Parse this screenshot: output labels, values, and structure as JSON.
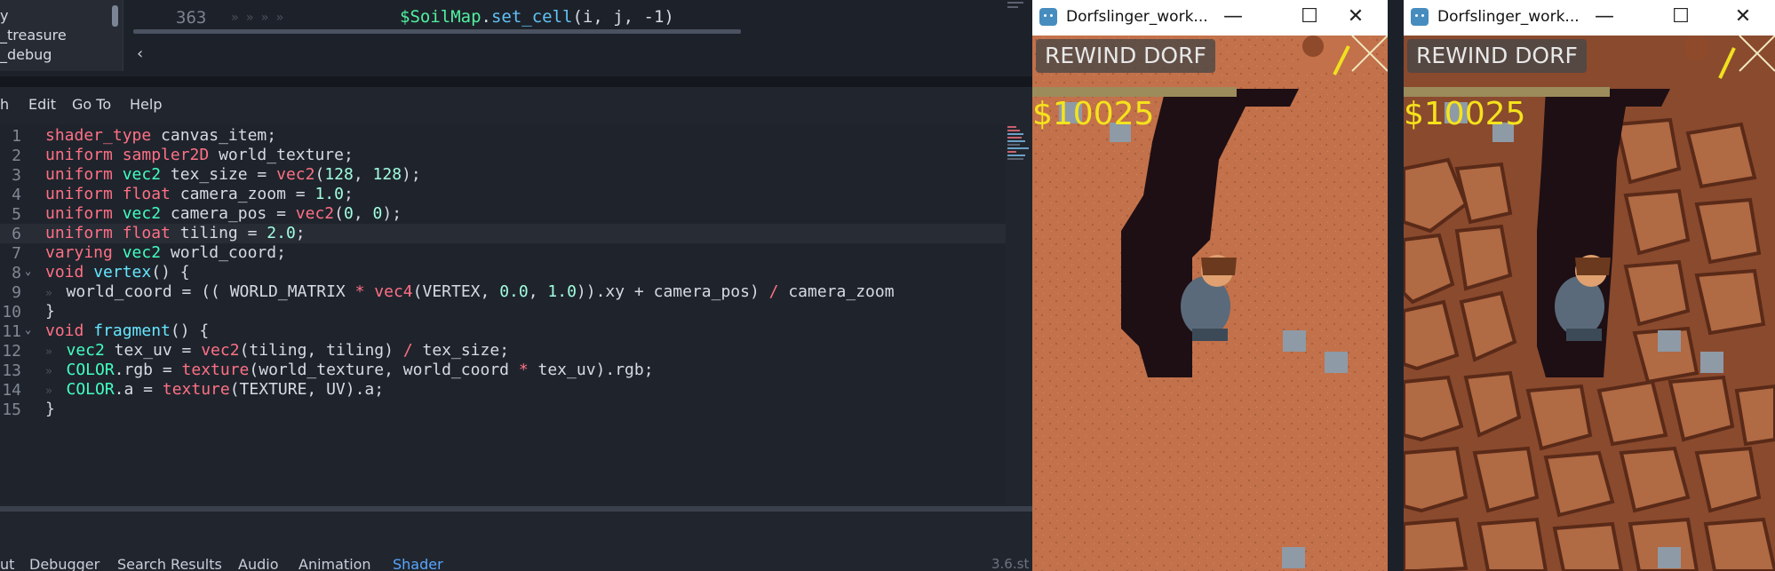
{
  "file_tree": {
    "items": [
      "y",
      "_treasure",
      "_debug"
    ]
  },
  "mini_code": {
    "line_number": "363",
    "segments": [
      {
        "text": "$SoilMap",
        "cls": "tok-var"
      },
      {
        "text": ".",
        "cls": "tok-def"
      },
      {
        "text": "set_cell",
        "cls": "tok-fn"
      },
      {
        "text": "(i, j, -1)",
        "cls": "tok-def"
      }
    ]
  },
  "menu": {
    "items": [
      "h",
      "Edit",
      "Go To",
      "Help"
    ]
  },
  "code": {
    "current_line": 6,
    "lines": [
      {
        "n": "1",
        "fold": "",
        "tokens": [
          [
            "kw",
            "shader_type"
          ],
          [
            "pl",
            " canvas_item;"
          ]
        ]
      },
      {
        "n": "2",
        "fold": "",
        "tokens": [
          [
            "kw",
            "uniform"
          ],
          [
            "pl",
            " "
          ],
          [
            "kw",
            "sampler2D"
          ],
          [
            "pl",
            " world_texture;"
          ]
        ]
      },
      {
        "n": "3",
        "fold": "",
        "tokens": [
          [
            "kw",
            "uniform"
          ],
          [
            "pl",
            " "
          ],
          [
            "ty",
            "vec2"
          ],
          [
            "pl",
            " tex_size = "
          ],
          [
            "kw",
            "vec2"
          ],
          [
            "pl",
            "("
          ],
          [
            "num",
            "128"
          ],
          [
            "pl",
            ", "
          ],
          [
            "num",
            "128"
          ],
          [
            "pl",
            ");"
          ]
        ]
      },
      {
        "n": "4",
        "fold": "",
        "tokens": [
          [
            "kw",
            "uniform"
          ],
          [
            "pl",
            " "
          ],
          [
            "kw",
            "float"
          ],
          [
            "pl",
            " camera_zoom = "
          ],
          [
            "num",
            "1.0"
          ],
          [
            "pl",
            ";"
          ]
        ]
      },
      {
        "n": "5",
        "fold": "",
        "tokens": [
          [
            "kw",
            "uniform"
          ],
          [
            "pl",
            " "
          ],
          [
            "ty",
            "vec2"
          ],
          [
            "pl",
            " camera_pos = "
          ],
          [
            "kw",
            "vec2"
          ],
          [
            "pl",
            "("
          ],
          [
            "num",
            "0"
          ],
          [
            "pl",
            ", "
          ],
          [
            "num",
            "0"
          ],
          [
            "pl",
            ");"
          ]
        ]
      },
      {
        "n": "6",
        "fold": "",
        "tokens": [
          [
            "kw",
            "uniform"
          ],
          [
            "pl",
            " "
          ],
          [
            "kw",
            "float"
          ],
          [
            "pl",
            " tiling = "
          ],
          [
            "num",
            "2.0"
          ],
          [
            "pl",
            ";"
          ]
        ]
      },
      {
        "n": "7",
        "fold": "",
        "tokens": [
          [
            "kw",
            "varying"
          ],
          [
            "pl",
            " "
          ],
          [
            "ty",
            "vec2"
          ],
          [
            "pl",
            " world_coord;"
          ]
        ]
      },
      {
        "n": "8",
        "fold": "⌄",
        "tokens": [
          [
            "kw",
            "void"
          ],
          [
            "pl",
            " "
          ],
          [
            "fnc",
            "vertex"
          ],
          [
            "pl",
            "() {"
          ]
        ]
      },
      {
        "n": "9",
        "fold": "",
        "tokens": [
          [
            "ind",
            "»  "
          ],
          [
            "pl",
            "world_coord = (( WORLD_MATRIX "
          ],
          [
            "kw",
            "*"
          ],
          [
            "pl",
            " "
          ],
          [
            "kw",
            "vec4"
          ],
          [
            "pl",
            "(VERTEX, "
          ],
          [
            "num",
            "0.0"
          ],
          [
            "pl",
            ", "
          ],
          [
            "num",
            "1.0"
          ],
          [
            "pl",
            ")).xy + camera_pos) "
          ],
          [
            "kw",
            "/"
          ],
          [
            "pl",
            " camera_zoom"
          ]
        ]
      },
      {
        "n": "10",
        "fold": "",
        "tokens": [
          [
            "pl",
            "}"
          ]
        ]
      },
      {
        "n": "11",
        "fold": "⌄",
        "tokens": [
          [
            "kw",
            "void"
          ],
          [
            "pl",
            " "
          ],
          [
            "fnc",
            "fragment"
          ],
          [
            "pl",
            "() {"
          ]
        ]
      },
      {
        "n": "12",
        "fold": "",
        "tokens": [
          [
            "ind",
            "»  "
          ],
          [
            "ty",
            "vec2"
          ],
          [
            "pl",
            " tex_uv = "
          ],
          [
            "kw",
            "vec2"
          ],
          [
            "pl",
            "(tiling, tiling) "
          ],
          [
            "kw",
            "/"
          ],
          [
            "pl",
            " tex_size;"
          ]
        ]
      },
      {
        "n": "13",
        "fold": "",
        "tokens": [
          [
            "ind",
            "»  "
          ],
          [
            "ty",
            "COLOR"
          ],
          [
            "pl",
            ".rgb = "
          ],
          [
            "kw",
            "texture"
          ],
          [
            "pl",
            "(world_texture, world_coord "
          ],
          [
            "kw",
            "*"
          ],
          [
            "pl",
            " tex_uv).rgb;"
          ]
        ]
      },
      {
        "n": "14",
        "fold": "",
        "tokens": [
          [
            "ind",
            "»  "
          ],
          [
            "ty",
            "COLOR"
          ],
          [
            "pl",
            ".a = "
          ],
          [
            "kw",
            "texture"
          ],
          [
            "pl",
            "(TEXTURE, UV).a;"
          ]
        ]
      },
      {
        "n": "15",
        "fold": "",
        "tokens": [
          [
            "pl",
            "}"
          ]
        ]
      }
    ]
  },
  "bottom_tabs": {
    "items": [
      {
        "label": "ut",
        "active": false
      },
      {
        "label": "Debugger",
        "active": false
      },
      {
        "label": "Search Results",
        "active": false
      },
      {
        "label": "Audio",
        "active": false
      },
      {
        "label": "Animation",
        "active": false
      },
      {
        "label": "Shader",
        "active": true
      }
    ]
  },
  "status": {
    "version": "3.6.st"
  },
  "windows": [
    {
      "title": "Dorfslinger_work...",
      "button": "REWIND DORF",
      "money": "$10025",
      "ground": "soil",
      "minimize": "—",
      "maximize": "☐",
      "close": "✕"
    },
    {
      "title": "Dorfslinger_work...",
      "button": "REWIND DORF",
      "money": "$10025",
      "ground": "rock",
      "minimize": "—",
      "maximize": "☐",
      "close": "✕"
    }
  ],
  "colors": {
    "editor_bg": "#21262e",
    "keyword": "#ff7085",
    "type": "#42ffc2",
    "number": "#a1ffe0",
    "function": "#66e6ff",
    "active_tab": "#57a6ff",
    "soil": "#c2714a",
    "rock": "#8a4a2e",
    "cave": "#1e0f14",
    "money": "#f5e31c"
  }
}
